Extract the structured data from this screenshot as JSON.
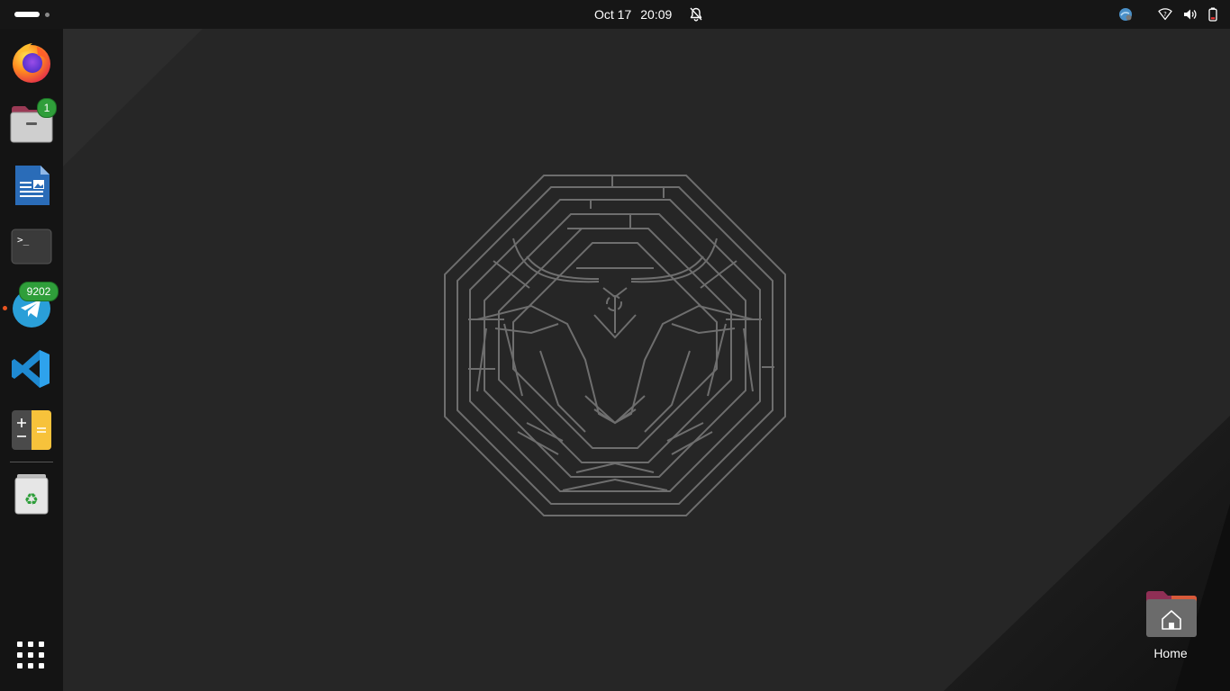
{
  "topbar": {
    "date": "Oct 17",
    "time": "20:09"
  },
  "dock": {
    "items": [
      {
        "name": "Firefox",
        "icon": "firefox-icon"
      },
      {
        "name": "Files",
        "icon": "files-icon",
        "badge": "1"
      },
      {
        "name": "LibreOffice Writer",
        "icon": "writer-icon"
      },
      {
        "name": "Terminal",
        "icon": "terminal-icon",
        "glyph": ">_"
      },
      {
        "name": "Telegram",
        "icon": "telegram-icon",
        "badge": "9202",
        "running": true
      },
      {
        "name": "Visual Studio Code",
        "icon": "vscode-icon"
      },
      {
        "name": "Calculator",
        "icon": "calculator-icon"
      },
      {
        "name": "Trash",
        "icon": "trash-icon"
      }
    ],
    "show_apps_icon": "app-grid-icon"
  },
  "desktop": {
    "home_label": "Home"
  },
  "colors": {
    "topbar_bg": "#161616",
    "dock_bg": "#141414",
    "wallpaper_bg": "#262626",
    "badge_green": "#2f9e3a",
    "running_indicator": "#e95420",
    "maze_stroke": "#6e6e6e"
  }
}
